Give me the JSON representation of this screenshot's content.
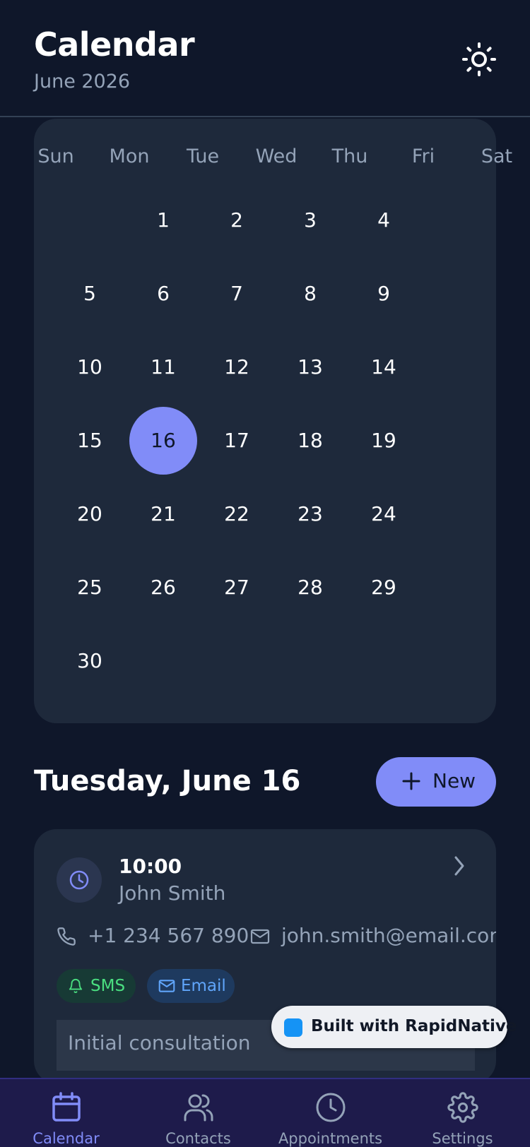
{
  "header": {
    "title": "Calendar",
    "subtitle": "June 2026",
    "theme_icon": "sun-icon"
  },
  "calendar": {
    "weekdays": [
      "Sun",
      "Mon",
      "Tue",
      "Wed",
      "Thu",
      "Fri",
      "Sat"
    ],
    "days": [
      [
        "",
        "1",
        "2",
        "3",
        "4",
        "",
        ""
      ],
      [
        "5",
        "6",
        "7",
        "8",
        "9",
        "",
        ""
      ],
      [
        "10",
        "11",
        "12",
        "13",
        "14",
        "",
        ""
      ],
      [
        "15",
        "16",
        "17",
        "18",
        "19",
        "",
        ""
      ],
      [
        "20",
        "21",
        "22",
        "23",
        "24",
        "",
        ""
      ],
      [
        "25",
        "26",
        "27",
        "28",
        "29",
        "",
        ""
      ],
      [
        "30",
        "",
        "",
        "",
        "",
        "",
        ""
      ]
    ],
    "selected_day": "16",
    "selected_color": "#818cf8"
  },
  "agenda": {
    "date_heading": "Tuesday, June 16",
    "new_button": "New"
  },
  "appointment": {
    "time": "10:00",
    "name": "John Smith",
    "phone": "+1 234 567 890",
    "email": "john.smith@email.com",
    "badges": {
      "sms": "SMS",
      "email": "Email"
    },
    "notes": "Initial consultation"
  },
  "watermark": {
    "text": "Built with RapidNative"
  },
  "tabs": [
    {
      "label": "Calendar",
      "icon": "calendar-icon",
      "active": true
    },
    {
      "label": "Contacts",
      "icon": "users-icon",
      "active": false
    },
    {
      "label": "Appointments",
      "icon": "clock-icon",
      "active": false
    },
    {
      "label": "Settings",
      "icon": "gear-icon",
      "active": false
    }
  ],
  "colors": {
    "background": "#0f172a",
    "card": "#1e293b",
    "accent": "#818cf8",
    "sms": "#4ade80",
    "email": "#60a5fa",
    "tabbar": "#1e1b4b"
  }
}
